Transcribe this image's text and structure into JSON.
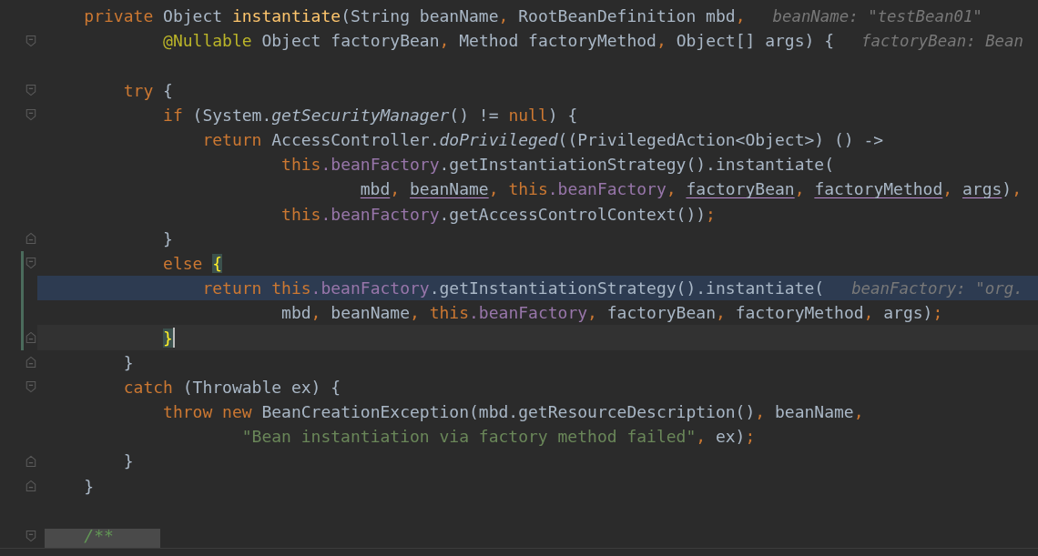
{
  "lines": [
    {
      "tokens": [
        {
          "t": "    private",
          "kind": "kw"
        },
        {
          "t": " Object ",
          "kind": "plain"
        },
        {
          "t": "instantiate",
          "kind": "decl"
        },
        {
          "t": "(String beanName",
          "kind": "plain"
        },
        {
          "t": ",",
          "kind": "punct"
        },
        {
          "t": " RootBeanDefinition mbd",
          "kind": "plain"
        },
        {
          "t": ",",
          "kind": "punct"
        }
      ],
      "hint": "beanName: \"testBean01\""
    },
    {
      "tokens": [
        {
          "t": "            @Nullable",
          "kind": "ann"
        },
        {
          "t": " Object factoryBean",
          "kind": "plain"
        },
        {
          "t": ",",
          "kind": "punct"
        },
        {
          "t": " Method factoryMethod",
          "kind": "plain"
        },
        {
          "t": ",",
          "kind": "punct"
        },
        {
          "t": " Object[] args) {",
          "kind": "plain"
        }
      ],
      "hint": "factoryBean: Bean",
      "fold_start": true
    },
    {
      "tokens": [
        {
          "t": "        try",
          "kind": "kw"
        },
        {
          "t": " {",
          "kind": "plain"
        }
      ],
      "fold_start": true,
      "blank_before": true
    },
    {
      "tokens": [
        {
          "t": "            if",
          "kind": "kw"
        },
        {
          "t": " (System.",
          "kind": "plain"
        },
        {
          "t": "getSecurityManager",
          "kind": "static"
        },
        {
          "t": "() != ",
          "kind": "plain"
        },
        {
          "t": "null",
          "kind": "kw"
        },
        {
          "t": ") {",
          "kind": "plain"
        }
      ],
      "fold_start": true
    },
    {
      "tokens": [
        {
          "t": "                return",
          "kind": "kw"
        },
        {
          "t": " AccessController.",
          "kind": "plain"
        },
        {
          "t": "doPrivileged",
          "kind": "static"
        },
        {
          "t": "((PrivilegedAction<Object>) () ->",
          "kind": "plain"
        }
      ]
    },
    {
      "tokens": [
        {
          "t": "                        this",
          "kind": "kw"
        },
        {
          "t": ".beanFactory",
          "kind": "field"
        },
        {
          "t": ".getInstantiationStrategy().instantiate(",
          "kind": "plain"
        }
      ]
    },
    {
      "tokens": [
        {
          "t": "                                mbd",
          "kind": "param"
        },
        {
          "t": ", ",
          "kind": "punct"
        },
        {
          "t": "beanName",
          "kind": "param"
        },
        {
          "t": ", ",
          "kind": "punct"
        },
        {
          "t": "this",
          "kind": "kw"
        },
        {
          "t": ".beanFactory",
          "kind": "field"
        },
        {
          "t": ", ",
          "kind": "punct"
        },
        {
          "t": "factoryBean",
          "kind": "param"
        },
        {
          "t": ", ",
          "kind": "punct"
        },
        {
          "t": "factoryMethod",
          "kind": "param"
        },
        {
          "t": ", ",
          "kind": "punct"
        },
        {
          "t": "args",
          "kind": "param"
        },
        {
          "t": ")",
          "kind": "plain"
        },
        {
          "t": ",",
          "kind": "punct"
        }
      ]
    },
    {
      "tokens": [
        {
          "t": "                        this",
          "kind": "kw"
        },
        {
          "t": ".beanFactory",
          "kind": "field"
        },
        {
          "t": ".getAccessControlContext())",
          "kind": "plain"
        },
        {
          "t": ";",
          "kind": "punct"
        }
      ]
    },
    {
      "tokens": [
        {
          "t": "            }",
          "kind": "plain"
        }
      ],
      "fold_end": true
    },
    {
      "tokens": [
        {
          "t": "            else ",
          "kind": "kw"
        },
        {
          "t": "{",
          "kind": "brace"
        }
      ],
      "fold_start": true,
      "changed": true
    },
    {
      "tokens": [
        {
          "t": "                return this",
          "kind": "kw"
        },
        {
          "t": ".beanFactory",
          "kind": "field"
        },
        {
          "t": ".getInstantiationStrategy().instantiate(",
          "kind": "plain"
        }
      ],
      "hint": "beanFactory: \"org.",
      "execution_point": true,
      "changed": true
    },
    {
      "tokens": [
        {
          "t": "                        mbd",
          "kind": "plain"
        },
        {
          "t": ",",
          "kind": "punct"
        },
        {
          "t": " beanName",
          "kind": "plain"
        },
        {
          "t": ", this",
          "kind": "kw"
        },
        {
          "t": ".beanFactory",
          "kind": "field"
        },
        {
          "t": ",",
          "kind": "punct"
        },
        {
          "t": " factoryBean",
          "kind": "plain"
        },
        {
          "t": ",",
          "kind": "punct"
        },
        {
          "t": " factoryMethod",
          "kind": "plain"
        },
        {
          "t": ",",
          "kind": "punct"
        },
        {
          "t": " args)",
          "kind": "plain"
        },
        {
          "t": ";",
          "kind": "punct"
        }
      ],
      "changed": true
    },
    {
      "tokens": [
        {
          "t": "            }",
          "kind": "brace"
        }
      ],
      "fold_end": true,
      "caret_line": true,
      "changed": true
    },
    {
      "tokens": [
        {
          "t": "        }",
          "kind": "plain"
        }
      ],
      "fold_end": true
    },
    {
      "tokens": [
        {
          "t": "        catch",
          "kind": "kw"
        },
        {
          "t": " (Throwable ex) {",
          "kind": "plain"
        }
      ],
      "fold_start": true
    },
    {
      "tokens": [
        {
          "t": "            throw new",
          "kind": "kw"
        },
        {
          "t": " BeanCreationException(mbd.getResourceDescription()",
          "kind": "plain"
        },
        {
          "t": ",",
          "kind": "punct"
        },
        {
          "t": " beanName",
          "kind": "plain"
        },
        {
          "t": ",",
          "kind": "punct"
        }
      ]
    },
    {
      "tokens": [
        {
          "t": "                    \"Bean instantiation via factory method failed\"",
          "kind": "str"
        },
        {
          "t": ",",
          "kind": "punct"
        },
        {
          "t": " ex)",
          "kind": "plain"
        },
        {
          "t": ";",
          "kind": "punct"
        }
      ]
    },
    {
      "tokens": [
        {
          "t": "        }",
          "kind": "plain"
        }
      ],
      "fold_end": true
    },
    {
      "tokens": [
        {
          "t": "    }",
          "kind": "plain"
        }
      ],
      "fold_end": true
    },
    {
      "tokens": [
        {
          "t": "    /**",
          "kind": "doc"
        }
      ],
      "fold_start": true,
      "folded": true,
      "blank_before": true
    }
  ]
}
